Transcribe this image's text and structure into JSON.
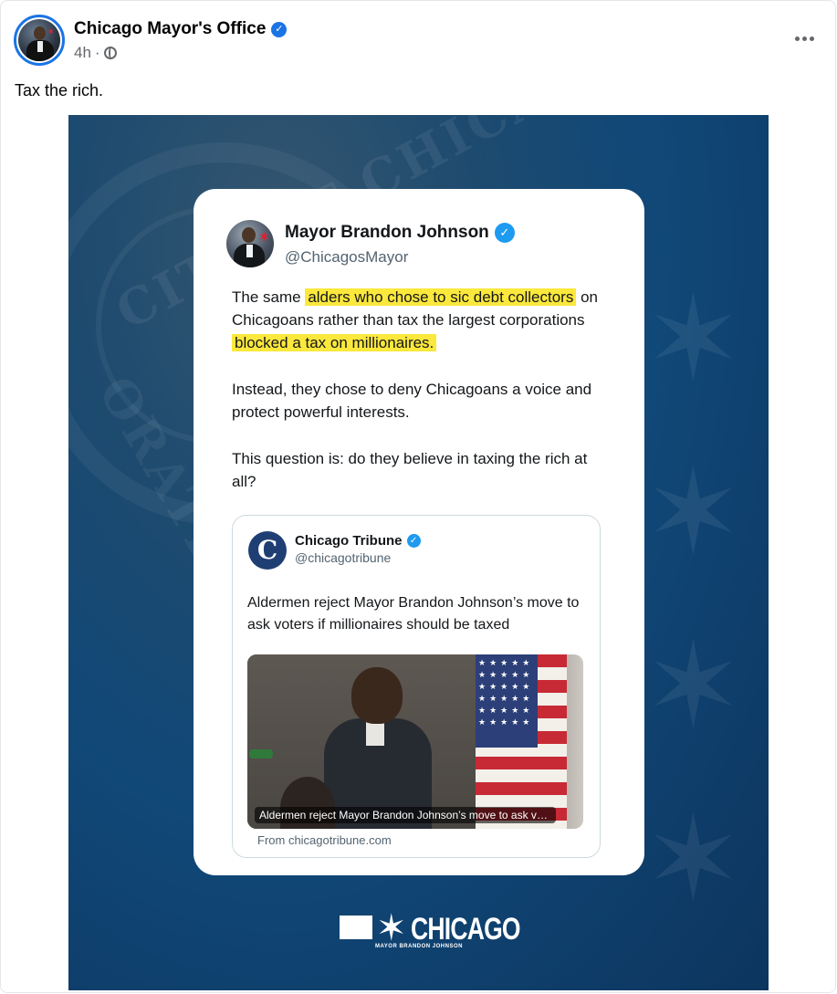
{
  "post": {
    "page_name": "Chicago Mayor's Office",
    "time": "4h",
    "separator": "·",
    "caption": "Tax the rich."
  },
  "tweet": {
    "name": "Mayor Brandon Johnson",
    "handle": "@ChicagosMayor",
    "p1_a": "The same ",
    "p1_hl1": "alders who chose to sic debt collectors",
    "p1_b": " on Chicagoans rather than tax the largest corporations ",
    "p1_hl2": "blocked a tax on millionaires.",
    "p2": "Instead, they chose to deny Chicagoans a voice and protect powerful interests.",
    "p3": "This question is: do they believe in taxing the rich at all?",
    "highlight_color": "#fbe83c"
  },
  "quote": {
    "logo_letter": "C",
    "name": "Chicago Tribune",
    "handle": "@chicagotribune",
    "headline": "Aldermen reject Mayor Brandon Johnson’s move to ask voters if millionaires should be taxed",
    "photo_caption": "Aldermen reject Mayor Brandon Johnson’s move to ask vot...",
    "source": "From chicagotribune.com"
  },
  "background": {
    "seal_text_top": "CITY OF CHICAGO",
    "seal_text_side": "ORATE"
  },
  "brand": {
    "text": "CHICAGO",
    "subtext": "MAYOR BRANDON JOHNSON"
  },
  "icons": {
    "verified": "verified-badge-icon",
    "audience": "globe-icon",
    "more": "more-options-icon"
  },
  "colors": {
    "facebook_blue": "#1b74e4",
    "twitter_blue": "#1d9bf0",
    "background_blue": "#104878"
  }
}
